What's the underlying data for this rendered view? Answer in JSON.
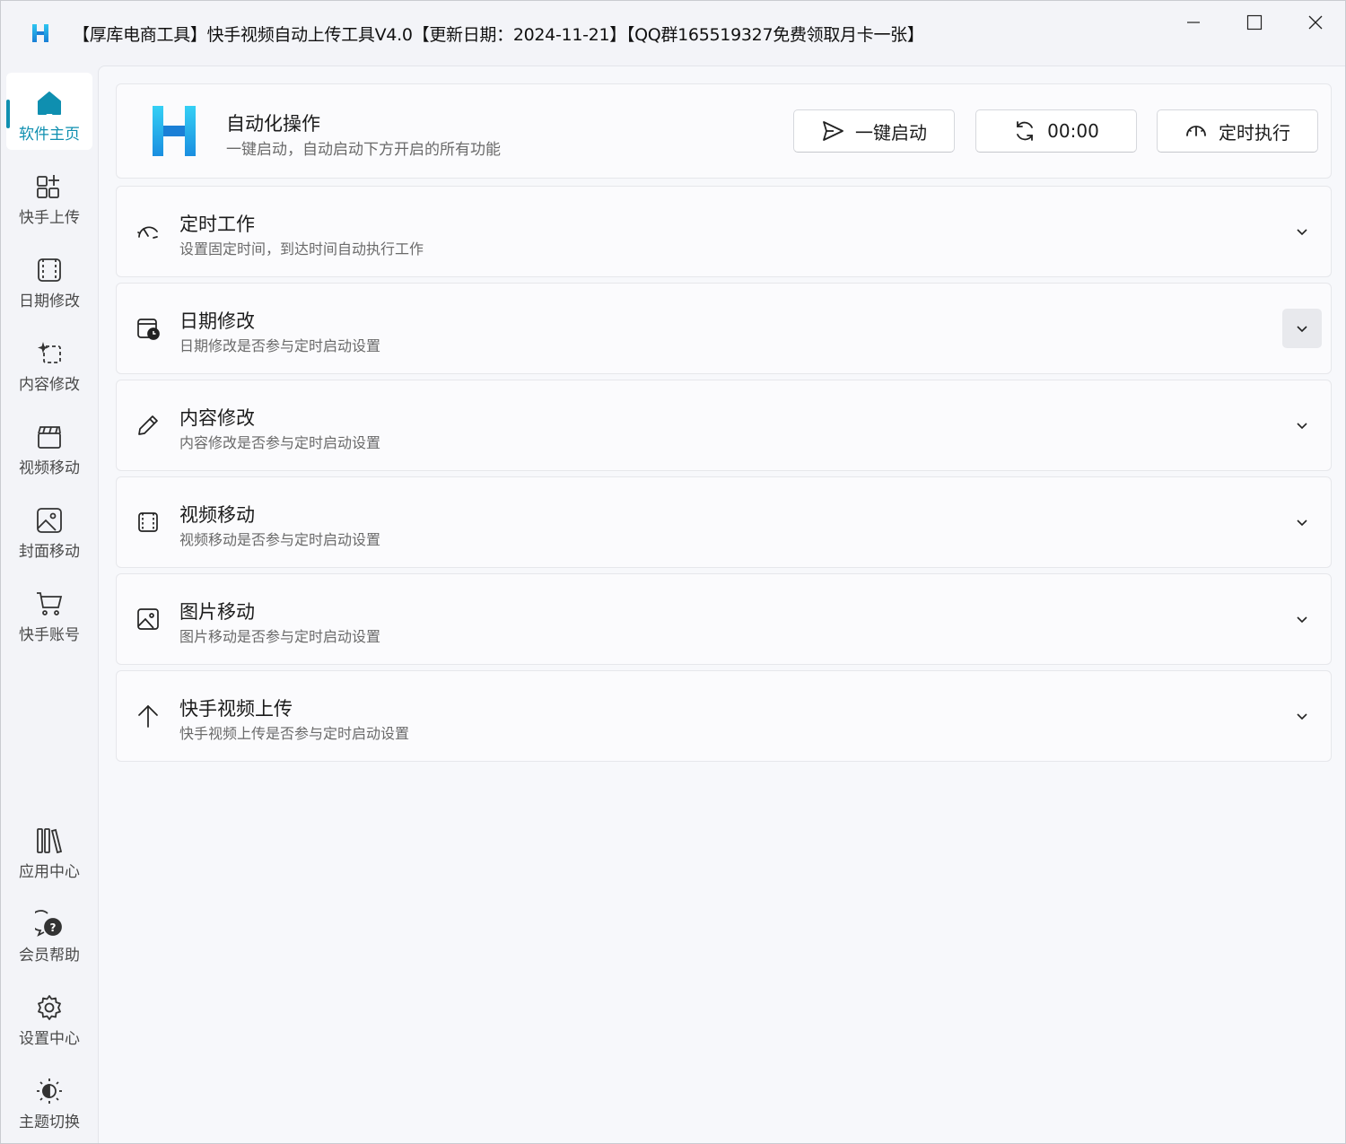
{
  "window": {
    "title": "【厚库电商工具】快手视频自动上传工具V4.0【更新日期：2024-11-21】【QQ群165519327免费领取月卡一张】",
    "controls": [
      "minimize-icon",
      "maximize-icon",
      "close-icon"
    ]
  },
  "colors": {
    "accent": "#0f8fb0",
    "logo_top": "#2ec5f0",
    "logo_bottom": "#1a7fd6"
  },
  "sidebar": {
    "items": [
      {
        "label": "软件主页",
        "icon": "home-icon",
        "active": true
      },
      {
        "label": "快手上传",
        "icon": "apps-add-icon"
      },
      {
        "label": "日期修改",
        "icon": "film-frame-icon"
      },
      {
        "label": "内容修改",
        "icon": "sparkle-select-icon"
      },
      {
        "label": "视频移动",
        "icon": "clapperboard-icon"
      },
      {
        "label": "封面移动",
        "icon": "image-icon"
      },
      {
        "label": "快手账号",
        "icon": "cart-icon"
      }
    ],
    "bottom_items": [
      {
        "label": "应用中心",
        "icon": "library-icon"
      },
      {
        "label": "会员帮助",
        "icon": "help-chat-icon"
      },
      {
        "label": "设置中心",
        "icon": "gear-icon"
      },
      {
        "label": "主题切换",
        "icon": "theme-icon"
      }
    ]
  },
  "hero": {
    "title": "自动化操作",
    "subtitle": "一键启动，自动启动下方开启的所有功能",
    "buttons": {
      "start": "一键启动",
      "timer": "00:00",
      "schedule": "定时执行"
    }
  },
  "cards": [
    {
      "title": "定时工作",
      "subtitle": "设置固定时间，到达时间自动执行工作",
      "icon": "gauge-icon"
    },
    {
      "title": "日期修改",
      "subtitle": "日期修改是否参与定时启动设置",
      "icon": "calendar-clock-icon"
    },
    {
      "title": "内容修改",
      "subtitle": "内容修改是否参与定时启动设置",
      "icon": "pencil-icon"
    },
    {
      "title": "视频移动",
      "subtitle": "视频移动是否参与定时启动设置",
      "icon": "film-icon"
    },
    {
      "title": "图片移动",
      "subtitle": "图片移动是否参与定时启动设置",
      "icon": "image-icon"
    },
    {
      "title": "快手视频上传",
      "subtitle": "快手视频上传是否参与定时启动设置",
      "icon": "upload-arrow-icon"
    }
  ]
}
